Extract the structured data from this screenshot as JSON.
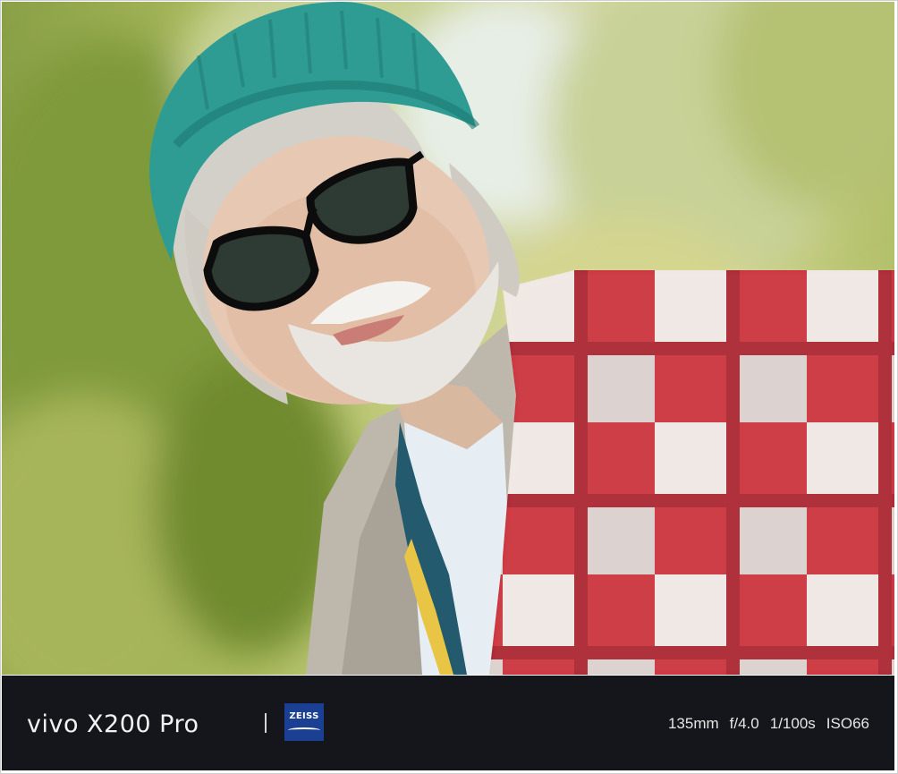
{
  "photo": {
    "subject": "portrait-photo"
  },
  "watermark": {
    "brand": "vivo X200 Pro",
    "separator": "|",
    "logo_text": "ZEISS",
    "logo_color": "#1b3f93",
    "bar_color": "#14161b",
    "exif": {
      "focal_length": "135mm",
      "aperture": "f/4.0",
      "shutter": "1/100s",
      "iso": "ISO66"
    }
  }
}
